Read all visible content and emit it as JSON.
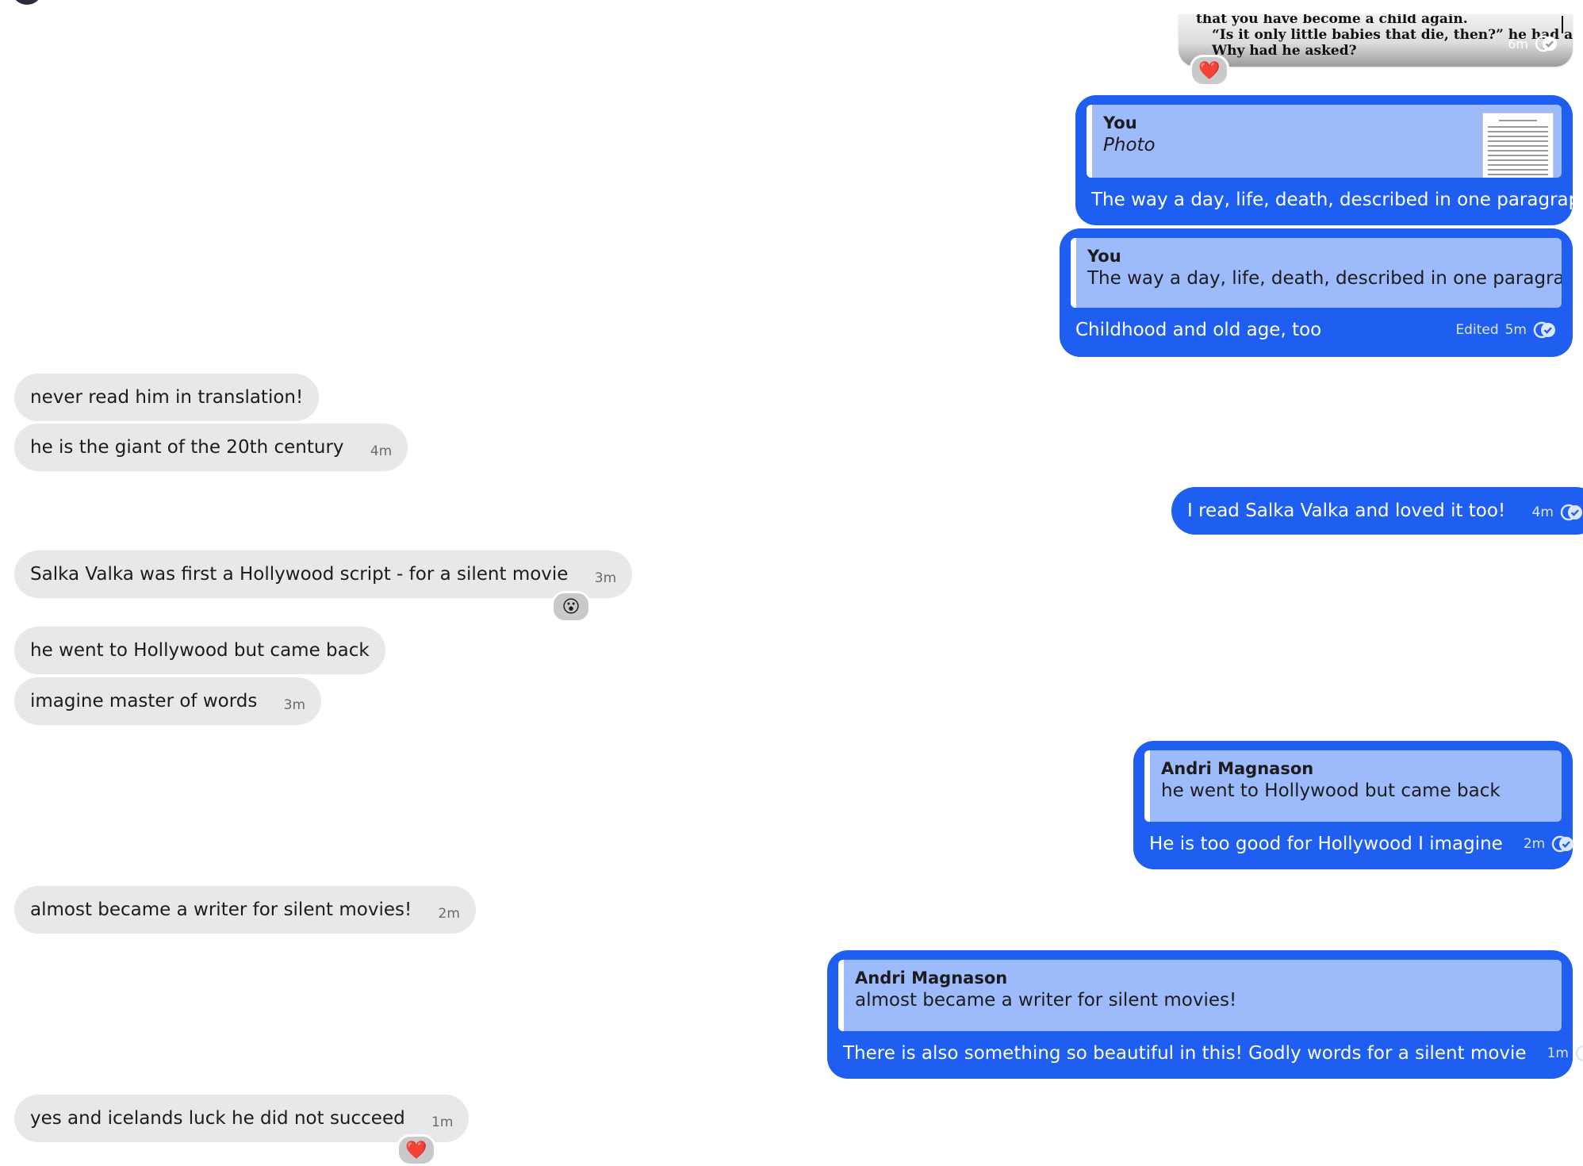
{
  "photo_message": {
    "lines": [
      "that you have become a child again.",
      "“Is it only little babies that die, then?” he had asked.",
      "Why had he asked?"
    ],
    "time": "6m",
    "reaction": "❤️"
  },
  "messages": [
    {
      "quote_name": "You",
      "quote_text": "Photo",
      "text": "The way a day, life, death, described in one paragraph"
    },
    {
      "quote_name": "You",
      "quote_text": "The way a day, life, death, described in one paragraph",
      "text": "Childhood and old age, too",
      "edited": "Edited",
      "time": "5m"
    },
    {
      "text": "never read him in translation!"
    },
    {
      "text": "he is the giant of the 20th century",
      "time": "4m"
    },
    {
      "text": "I read Salka Valka and loved it too!",
      "time": "4m"
    },
    {
      "text": "Salka Valka was first a Hollywood script - for a silent movie",
      "time": "3m",
      "reaction": "😮"
    },
    {
      "text": "he went to Hollywood but came back"
    },
    {
      "text": "imagine master of words",
      "time": "3m"
    },
    {
      "quote_name": "Andri Magnason",
      "quote_text": "he went to Hollywood but came back",
      "text": "He is too good for Hollywood I imagine",
      "time": "2m"
    },
    {
      "text": "almost became a writer for silent movies!",
      "time": "2m"
    },
    {
      "quote_name": "Andri Magnason",
      "quote_text": "almost became a writer for silent movies!",
      "text": "There is also something so beautiful in this! Godly words for a silent movie",
      "time": "1m"
    },
    {
      "text": "yes and icelands luck he did not succeed",
      "time": "1m",
      "reaction": "❤️"
    }
  ],
  "colors": {
    "outgoing": "#1e5ff2",
    "quote": "#9dbbfa",
    "incoming": "#e8e8e9"
  },
  "icons": {
    "read_receipt": "double-check-icon"
  }
}
